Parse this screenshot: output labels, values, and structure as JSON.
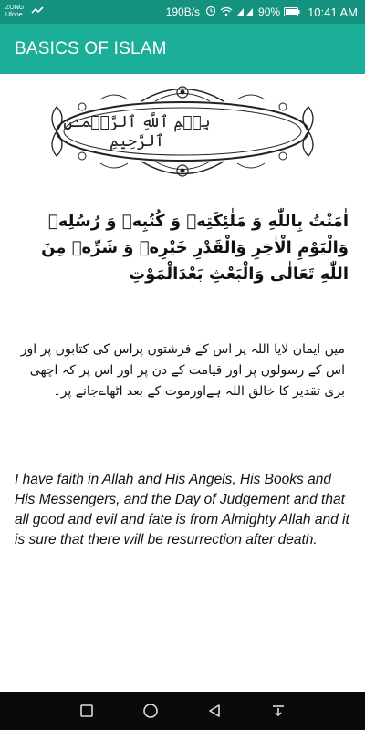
{
  "status_bar": {
    "carrier_1": "ZONG",
    "carrier_2": "Ufone",
    "net_speed": "190B/s",
    "battery": "90%",
    "time": "10:41 AM",
    "icons": [
      "signal-icon",
      "wifi-icon",
      "battery-icon",
      "message-icon"
    ]
  },
  "app_bar": {
    "title": "BASICS OF ISLAM"
  },
  "main": {
    "bismillah": "بِسۡمِ ٱللَّهِ ٱلرَّحۡمَـٰنِ ٱلرَّحِيمِ",
    "arabic_verse": "اٰمَنْتُ بِاللّٰهِ وَ مَلٰئِکَتِهٖ وَ کُتُبِهٖ وَ رُسُلِهٖ وَالْیَوْمِ الْاٰخِرِ وَالْقَدْرِ خَیْرِهٖ وَ شَرِّهٖ مِنَ اللّٰهِ تَعَالٰی وَالْبَعْثِ بَعْدَالْمَوْتِ",
    "urdu_translation": "میں ایمان لایا اللہ پر اس کے فرشتوں پراس کی کتابوں پر اور اس کے رسولوں پر اور قیامت کے دن پر اور اس پر کہ اچھی بری تقدیر کا خالق اللہ ہےاورموت کے بعد اٹھاےجانے پر۔",
    "english_translation": "I have faith in Allah and His Angels, His Books and His Messengers, and the Day of Judgement and that all good and evil and fate is from Almighty Allah and it is sure that there will be resurrection after death."
  },
  "nav_bar": {
    "icons": [
      "recent-apps-icon",
      "home-icon",
      "back-icon",
      "notification-pull-icon"
    ]
  },
  "colors": {
    "status_bar": "#15927f",
    "app_bar": "#1bae98",
    "nav_bar": "#0a0a0a"
  }
}
